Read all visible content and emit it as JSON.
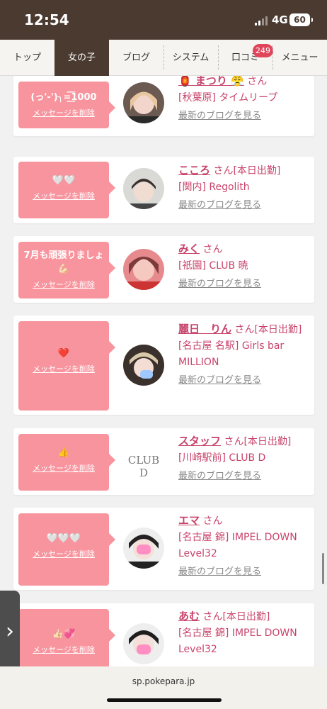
{
  "status": {
    "time": "12:54",
    "network": "4G",
    "battery": "60"
  },
  "nav": {
    "tabs": [
      "トップ",
      "女の子",
      "ブログ",
      "システム",
      "口コミ",
      "メニュー"
    ],
    "active": "女の子",
    "reviews_badge": "249"
  },
  "cards": [
    {
      "message": "(っ'-')╮=͟͟͞͞1000",
      "delete": "メッセージを削除",
      "name": "🏮 まつり 😤",
      "san": " さん",
      "shop": "[秋葉原] タイムリープ",
      "blog": "最新のブログを見る"
    },
    {
      "message": "🤍🤍",
      "delete": "メッセージを削除",
      "name": "こころ",
      "san": " さん[本日出勤]",
      "shop": "[関内] Regolith",
      "blog": "最新のブログを見る"
    },
    {
      "message": "7月も頑張りましょ💪🏻",
      "delete": "メッセージを削除",
      "name": "みく",
      "san": " さん",
      "shop": "[祇園] CLUB 暁",
      "blog": "最新のブログを見る"
    },
    {
      "message": "❤️",
      "delete": "メッセージを削除",
      "name": "麗日　りん",
      "san": " さん[本日出勤]",
      "shop": "[名古屋 名駅] Girls bar MILLION",
      "blog": "最新のブログを見る"
    },
    {
      "message": "👍",
      "delete": "メッセージを削除",
      "name": "スタッフ",
      "san": " さん[本日出勤]",
      "shop": "[川崎駅前] CLUB D",
      "blog": "最新のブログを見る"
    },
    {
      "message": "🤍🤍🤍",
      "delete": "メッセージを削除",
      "name": "エマ",
      "san": " さん",
      "shop": "[名古屋 錦] IMPEL DOWN Level32",
      "blog": "最新のブログを見る"
    },
    {
      "message": "👍🏻💞",
      "delete": "メッセージを削除",
      "name": "あむ",
      "san": " さん[本日出勤]",
      "shop": "[名古屋 錦] IMPEL DOWN Level32",
      "blog": ""
    }
  ],
  "club_logo_text": "CLUB D",
  "side_tab_glyph": "›",
  "url": "sp.pokepara.jp",
  "colors": {
    "brand": "#4a3a30",
    "bubble": "#f8949e",
    "link": "#c8446c",
    "badge": "#e0455a"
  }
}
